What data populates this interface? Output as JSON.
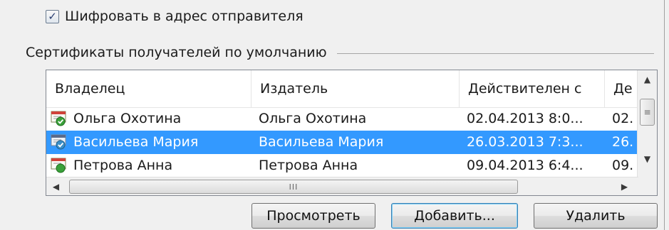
{
  "encrypt": {
    "label": "Шифровать в адрес отправителя",
    "checked": true
  },
  "group": {
    "title": "Сертификаты получателей по умолчанию"
  },
  "table": {
    "columns": [
      "Владелец",
      "Издатель",
      "Действителен с",
      "Де"
    ],
    "rows": [
      {
        "owner": "Ольга Охотина",
        "issuer": "Ольга Охотина",
        "valid_from": "02.04.2013 8:0...",
        "valid_to": "02.",
        "selected": false
      },
      {
        "owner": "Васильева Мария",
        "issuer": "Васильева Мария",
        "valid_from": "26.03.2013 7:3...",
        "valid_to": "26.",
        "selected": true
      },
      {
        "owner": "Петрова Анна",
        "issuer": "Петрова Анна",
        "valid_from": "09.04.2013 6:4...",
        "valid_to": "09.",
        "selected": false
      }
    ]
  },
  "scroll": {
    "grip": "III",
    "vgrip": "≡"
  },
  "buttons": {
    "view": "Просмотреть",
    "add": "Добавить...",
    "delete": "Удалить"
  },
  "icons": {
    "checkbox": "check-icon",
    "certificate": "certificate-icon"
  }
}
